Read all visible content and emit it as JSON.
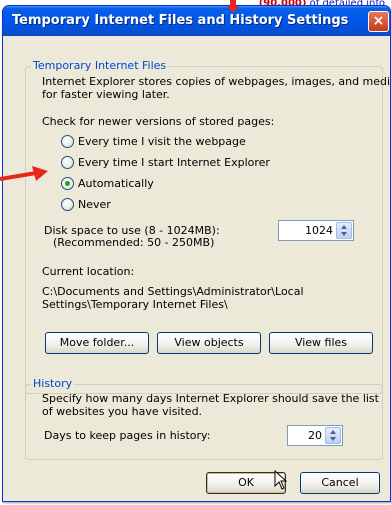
{
  "background": {
    "snippet_red": "(90.000)",
    "snippet_text": " of detailed info"
  },
  "window": {
    "title": "Temporary Internet Files and History Settings",
    "close_label": "×"
  },
  "temp_files": {
    "legend": "Temporary Internet Files",
    "description_line1": "Internet Explorer stores copies of webpages, images, and media",
    "description_line2": "for faster viewing later.",
    "check_label": "Check for newer versions of stored pages:",
    "options": [
      {
        "label": "Every time I visit the webpage",
        "checked": false
      },
      {
        "label": "Every time I start Internet Explorer",
        "checked": false
      },
      {
        "label": "Automatically",
        "checked": true
      },
      {
        "label": "Never",
        "checked": false
      }
    ],
    "disk_label_line1": "Disk space to use (8 - 1024MB):",
    "disk_label_line2": "(Recommended: 50 - 250MB)",
    "disk_value": "1024",
    "location_label": "Current location:",
    "location_line1": "C:\\Documents and Settings\\Administrator\\Local",
    "location_line2": "Settings\\Temporary Internet Files\\",
    "buttons": {
      "move": "Move folder...",
      "view_objects": "View objects",
      "view_files": "View files"
    }
  },
  "history": {
    "legend": "History",
    "description_line1": "Specify how many days Internet Explorer should save the list",
    "description_line2": "of websites you have visited.",
    "days_label": "Days to keep pages in history:",
    "days_value": "20"
  },
  "footer": {
    "ok": "OK",
    "cancel": "Cancel"
  },
  "colors": {
    "titlebar": "#0058ee",
    "group_label": "#0046d5",
    "annotation": "#e8271c"
  }
}
